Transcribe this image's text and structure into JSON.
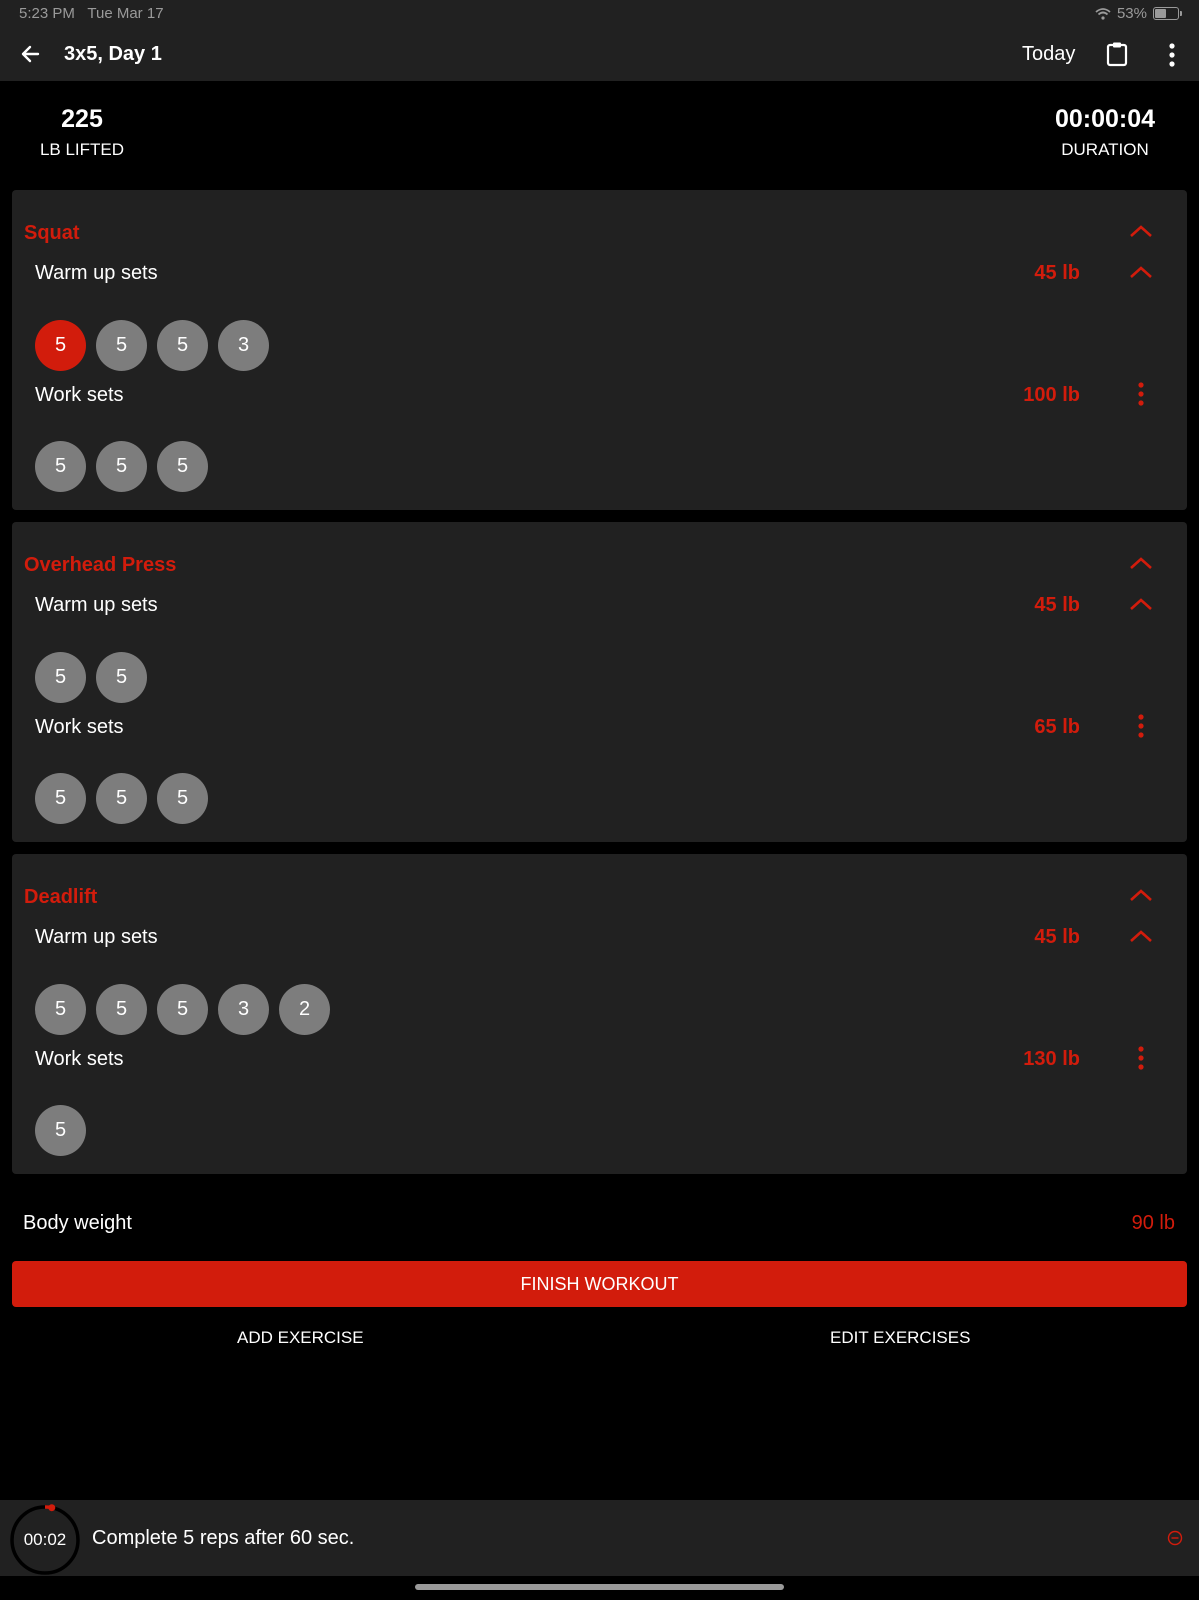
{
  "status": {
    "time": "5:23 PM",
    "date": "Tue Mar 17",
    "battery": "53%",
    "battery_level": 0.53
  },
  "header": {
    "title": "3x5, Day 1",
    "today_label": "Today"
  },
  "stats": {
    "lifted_value": "225",
    "lifted_label": "LB LIFTED",
    "duration_value": "00:00:04",
    "duration_label": "DURATION"
  },
  "exercises": [
    {
      "name": "Squat",
      "warmup": {
        "label": "Warm up sets",
        "weight": "45 lb",
        "sets": [
          "5",
          "5",
          "5",
          "3"
        ]
      },
      "work": {
        "label": "Work sets",
        "weight": "100 lb",
        "sets": [
          "5",
          "5",
          "5"
        ]
      }
    },
    {
      "name": "Overhead Press",
      "warmup": {
        "label": "Warm up sets",
        "weight": "45 lb",
        "sets": [
          "5",
          "5"
        ]
      },
      "work": {
        "label": "Work sets",
        "weight": "65 lb",
        "sets": [
          "5",
          "5",
          "5"
        ]
      }
    },
    {
      "name": "Deadlift",
      "warmup": {
        "label": "Warm up sets",
        "weight": "45 lb",
        "sets": [
          "5",
          "5",
          "5",
          "3",
          "2"
        ]
      },
      "work": {
        "label": "Work sets",
        "weight": "130 lb",
        "sets": [
          "5"
        ]
      }
    }
  ],
  "body_weight": {
    "label": "Body weight",
    "value": "90 lb"
  },
  "actions": {
    "finish": "FINISH WORKOUT",
    "add": "ADD EXERCISE",
    "edit": "EDIT EXERCISES"
  },
  "timer": {
    "value": "00:02",
    "message": "Complete 5 reps after 60 sec.",
    "progress": 0.033
  },
  "colors": {
    "accent": "#d21c0c",
    "surface": "#212121",
    "set_inactive": "#7d7d7d",
    "background": "#000000"
  },
  "icons": {
    "back": "arrow-left-icon",
    "clipboard": "clipboard-icon",
    "more": "more-vertical-icon",
    "chevron": "chevron-up-icon",
    "dismiss": "minus-circle-icon",
    "wifi": "wifi-icon",
    "battery": "battery-icon"
  }
}
